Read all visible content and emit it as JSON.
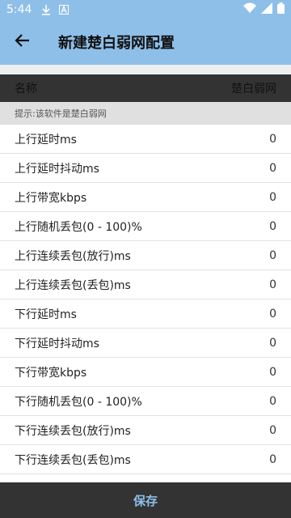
{
  "status_bar": {
    "time": "5:44",
    "icons": [
      "download-icon",
      "a-box-icon",
      "wifi-icon",
      "signal-icon",
      "battery-icon"
    ]
  },
  "app_bar": {
    "title": "新建楚白弱网配置",
    "back_icon": "arrow-left-icon"
  },
  "header": {
    "name_label": "名称",
    "name_value": "楚白弱网"
  },
  "hint": "提示:该软件是楚白弱网",
  "items": [
    {
      "label": "上行延时ms",
      "value": "0"
    },
    {
      "label": "上行延时抖动ms",
      "value": "0"
    },
    {
      "label": "上行带宽kbps",
      "value": "0"
    },
    {
      "label": "上行随机丢包(0 - 100)%",
      "value": "0"
    },
    {
      "label": "上行连续丢包(放行)ms",
      "value": "0"
    },
    {
      "label": "上行连续丢包(丢包)ms",
      "value": "0"
    },
    {
      "label": "下行延时ms",
      "value": "0"
    },
    {
      "label": "下行延时抖动ms",
      "value": "0"
    },
    {
      "label": "下行带宽kbps",
      "value": "0"
    },
    {
      "label": "下行随机丢包(0 - 100)%",
      "value": "0"
    },
    {
      "label": "下行连续丢包(放行)ms",
      "value": "0"
    },
    {
      "label": "下行连续丢包(丢包)ms",
      "value": "0"
    }
  ],
  "save_label": "保存",
  "colors": {
    "primary": "#8ebfe9",
    "dark_bar": "#333333",
    "hint_bg": "#e0e0e0"
  }
}
